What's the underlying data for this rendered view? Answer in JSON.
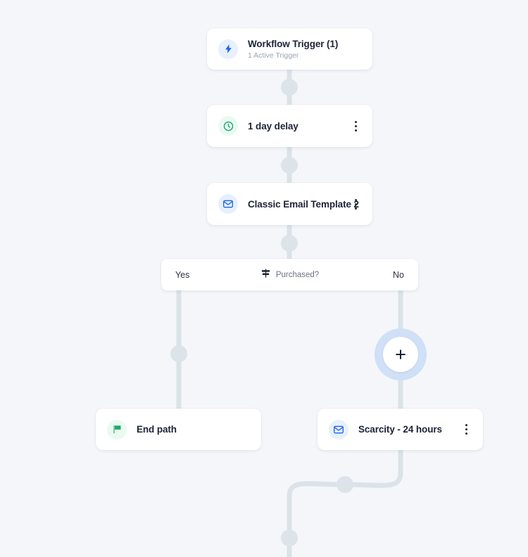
{
  "canvas": {
    "background_color": "#f4f6fa",
    "connector_color": "#dbe3e8",
    "connector_dot_color": "#dde4e9"
  },
  "nodes": [
    {
      "id": "workflow-trigger",
      "title": "Workflow Trigger (1)",
      "subtitle": "1 Active Trigger",
      "icon": "lightning-bolt-icon",
      "icon_color": "#1a63f0",
      "has_menu": false
    },
    {
      "id": "delay",
      "title": "1 day delay",
      "subtitle": "",
      "icon": "clock-icon",
      "icon_color": "#22a86c",
      "has_menu": true
    },
    {
      "id": "email-template",
      "title": "Classic Email Template 2",
      "subtitle": "",
      "icon": "envelope-icon",
      "icon_color": "#1a63f0",
      "has_menu": true
    },
    {
      "id": "end-path",
      "title": "End path",
      "subtitle": "",
      "icon": "flag-icon",
      "icon_color": "#22a86c",
      "has_menu": false
    },
    {
      "id": "scarcity",
      "title": "Scarcity - 24 hours",
      "subtitle": "",
      "icon": "envelope-icon",
      "icon_color": "#1a63f0",
      "has_menu": true
    }
  ],
  "branch": {
    "yes_label": "Yes",
    "no_label": "No",
    "condition_label": "Purchased?",
    "icon": "signpost-icon"
  },
  "add_button": {
    "label": "+",
    "icon": "plus-icon",
    "halo_color": "#cfe0f7"
  },
  "menu": {
    "icon": "kebab-menu-icon"
  }
}
